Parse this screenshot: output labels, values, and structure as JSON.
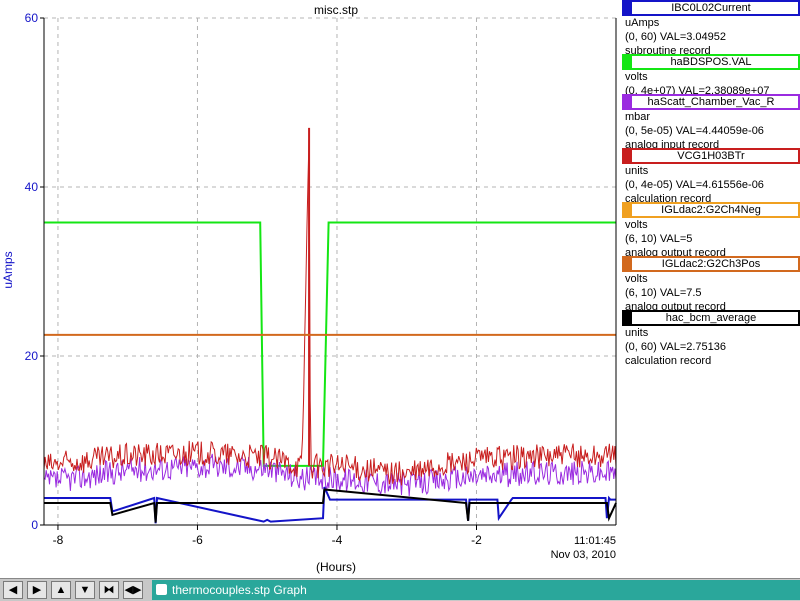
{
  "chart_data": {
    "type": "line",
    "title": "misc.stp",
    "xlabel": "(Hours)",
    "ylabel": "uAmps",
    "xlim": [
      -8.2,
      0
    ],
    "ylim": [
      0,
      60
    ],
    "x_ticks": [
      -8,
      -6,
      -4,
      -2
    ],
    "y_ticks": [
      0,
      20,
      40,
      60
    ],
    "grid": true,
    "timestamp_time": "11:01:45",
    "timestamp_date": "Nov 03, 2010",
    "series": [
      {
        "name": "IBC0L02Current",
        "color": "#1414c8",
        "kind": "step",
        "x": [
          -8.2,
          -7.25,
          -7.22,
          -6.62,
          -6.6,
          -6.58,
          -5.05,
          -5.0,
          -4.95,
          -4.2,
          -4.18,
          -4.1,
          -2.15,
          -2.12,
          -2.1,
          -1.7,
          -1.68,
          -1.5,
          -1.48,
          -0.15,
          -0.13,
          -0.1,
          -0.08,
          0
        ],
        "y": [
          3.2,
          3.2,
          1.6,
          3.2,
          0.2,
          3.2,
          0.4,
          0.6,
          0.4,
          0.8,
          4.5,
          3.0,
          3.0,
          0.5,
          3.0,
          3.0,
          0.8,
          3.0,
          3.2,
          3.2,
          0.8,
          3.2,
          3.0,
          3.0
        ]
      },
      {
        "name": "haBDSPOS.VAL",
        "color": "#14e614",
        "kind": "step",
        "x": [
          -8.2,
          -5.1,
          -5.05,
          -4.2,
          -4.12,
          0
        ],
        "y": [
          35.8,
          35.8,
          7.0,
          7.0,
          35.8,
          35.8
        ]
      },
      {
        "name": "haScatt_Chamber_Vac_R",
        "color": "#9a2be0",
        "kind": "band",
        "x": [
          -8.2,
          -7.0,
          -6.0,
          -5.0,
          -4.5,
          -4.0,
          -3.5,
          -3.0,
          -2.5,
          -2.0,
          -1.0,
          0
        ],
        "y": [
          5.0,
          6.5,
          7.0,
          6.8,
          5.5,
          5.5,
          5.2,
          4.8,
          5.3,
          5.8,
          6.2,
          6.2
        ]
      },
      {
        "name": "VCG1H03BTr",
        "color": "#c81e1e",
        "kind": "band",
        "x": [
          -8.2,
          -7.0,
          -6.0,
          -5.0,
          -4.5,
          -4.4,
          -4.38,
          -4.0,
          -3.5,
          -3.0,
          -2.5,
          -2.0,
          -1.0,
          0
        ],
        "y": [
          7.0,
          8.2,
          8.5,
          8.0,
          7.0,
          47.0,
          7.0,
          7.0,
          6.5,
          6.0,
          7.0,
          7.8,
          8.2,
          8.2
        ]
      },
      {
        "name": "IGLdac2:G2Ch4Neg",
        "color": "#f0a020",
        "kind": "step",
        "x": [],
        "y": []
      },
      {
        "name": "IGLdac2:G2Ch3Pos",
        "color": "#d2691e",
        "kind": "step",
        "x": [
          -8.2,
          0
        ],
        "y": [
          22.5,
          22.5
        ]
      },
      {
        "name": "hac_bcm_average",
        "color": "#000000",
        "kind": "step",
        "x": [
          -8.2,
          -7.25,
          -7.22,
          -6.62,
          -6.6,
          -6.58,
          -4.2,
          -4.18,
          -2.15,
          -2.12,
          -2.1,
          -0.13,
          -0.1,
          0
        ],
        "y": [
          2.6,
          2.6,
          1.2,
          2.6,
          0.3,
          2.6,
          2.6,
          4.2,
          2.6,
          0.5,
          2.6,
          2.6,
          0.8,
          2.6
        ]
      }
    ]
  },
  "legend": {
    "entries": [
      {
        "name": "IBC0L02Current",
        "color": "#1414c8",
        "units": "uAmps",
        "range": "(0, 60) VAL=3.04952",
        "record": "subroutine record"
      },
      {
        "name": "haBDSPOS.VAL",
        "color": "#14e614",
        "units": "volts",
        "range": "(0, 4e+07) VAL=2.38089e+07",
        "record": ""
      },
      {
        "name": "haScatt_Chamber_Vac_R",
        "color": "#9a2be0",
        "units": "mbar",
        "range": "(0, 5e-05) VAL=4.44059e-06",
        "record": "analog input record"
      },
      {
        "name": "VCG1H03BTr",
        "color": "#c81e1e",
        "units": "units",
        "range": "(0, 4e-05) VAL=4.61556e-06",
        "record": "calculation record"
      },
      {
        "name": "IGLdac2:G2Ch4Neg",
        "color": "#f0a020",
        "units": "volts",
        "range": "(6, 10) VAL=5",
        "record": "analog output record"
      },
      {
        "name": "IGLdac2:G2Ch3Pos",
        "color": "#d2691e",
        "units": "volts",
        "range": "(6, 10) VAL=7.5",
        "record": "analog output record"
      },
      {
        "name": "hac_bcm_average",
        "color": "#000000",
        "units": "units",
        "range": "(0, 60) VAL=2.75136",
        "record": "calculation record"
      }
    ]
  },
  "taskbar": {
    "buttons": [
      {
        "icon": "arrow-left-icon",
        "glyph": "◀"
      },
      {
        "icon": "arrow-right-icon",
        "glyph": "▶"
      },
      {
        "icon": "arrow-up-icon",
        "glyph": "▲"
      },
      {
        "icon": "arrow-down-icon",
        "glyph": "▼"
      },
      {
        "icon": "shrink-horizontal-icon",
        "glyph": "⧓"
      },
      {
        "icon": "expand-horizontal-icon",
        "glyph": "◀▶"
      }
    ],
    "task_label": "thermocouples.stp Graph",
    "colors": {
      "bar": "#c8c8c8",
      "task": "#2aa79b"
    }
  }
}
